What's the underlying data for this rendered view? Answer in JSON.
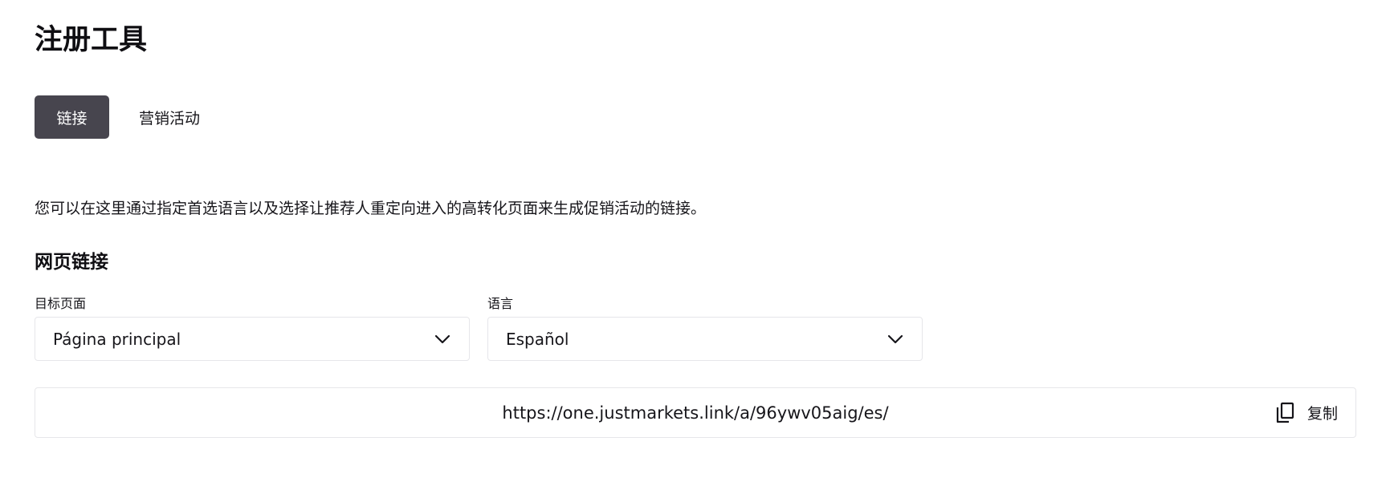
{
  "page": {
    "title": "注册工具"
  },
  "tabs": [
    {
      "label": "链接",
      "active": true
    },
    {
      "label": "营销活动",
      "active": false
    }
  ],
  "description": "您可以在这里通过指定首选语言以及选择让推荐人重定向进入的高转化页面来生成促销活动的链接。",
  "web_link": {
    "section_title": "网页链接",
    "target_page": {
      "label": "目标页面",
      "value": "Página principal",
      "icon": "chevron-down-icon"
    },
    "language": {
      "label": "语言",
      "value": "Español",
      "icon": "chevron-down-icon"
    },
    "generated_link": {
      "url": "https://one.justmarkets.link/a/96ywv05aig/es/",
      "copy_label": "复制",
      "copy_icon": "copy-icon"
    }
  },
  "colors": {
    "active_tab_bg": "#47454e",
    "active_tab_text": "#ffffff",
    "text": "#16151a",
    "border": "#e6e6ea"
  }
}
